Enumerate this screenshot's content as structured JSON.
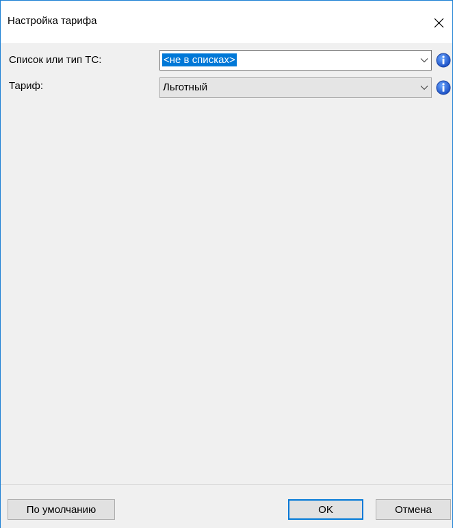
{
  "window": {
    "title": "Настройка тарифа",
    "close_icon": "close-icon",
    "accent_color": "#0078d7"
  },
  "form": {
    "vehicle_list": {
      "label": "Список или тип ТС:",
      "value": "<не в списках>",
      "icon": "info-icon"
    },
    "tariff": {
      "label": "Тариф:",
      "value": "Льготный",
      "icon": "info-icon"
    }
  },
  "footer": {
    "default_label": "По умолчанию",
    "ok_label": "OK",
    "cancel_label": "Отмена"
  }
}
